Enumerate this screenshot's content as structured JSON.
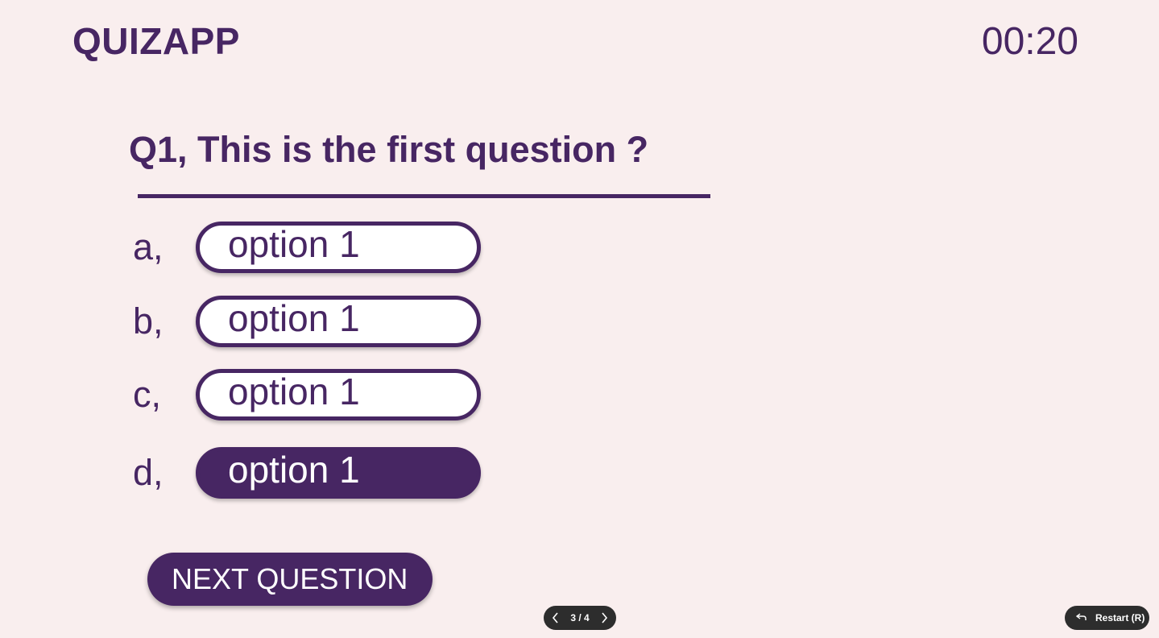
{
  "header": {
    "app_title": "QUIZAPP",
    "timer": "00:20"
  },
  "question": {
    "text": "Q1, This is the first question ?"
  },
  "options": [
    {
      "letter": "a,",
      "label": "option 1",
      "selected": false
    },
    {
      "letter": "b,",
      "label": "option 1",
      "selected": false
    },
    {
      "letter": "c,",
      "label": "option 1",
      "selected": false
    },
    {
      "letter": "d,",
      "label": "option 1",
      "selected": true
    }
  ],
  "next_button": {
    "label": "NEXT QUESTION"
  },
  "pager": {
    "text": "3 / 4",
    "prev_icon": "chevron-left-icon",
    "next_icon": "chevron-right-icon"
  },
  "restart": {
    "label": "Restart (R)",
    "icon": "undo-icon"
  },
  "colors": {
    "background": "#f9eeee",
    "accent": "#472663",
    "control_bar": "#2d2d2d"
  }
}
